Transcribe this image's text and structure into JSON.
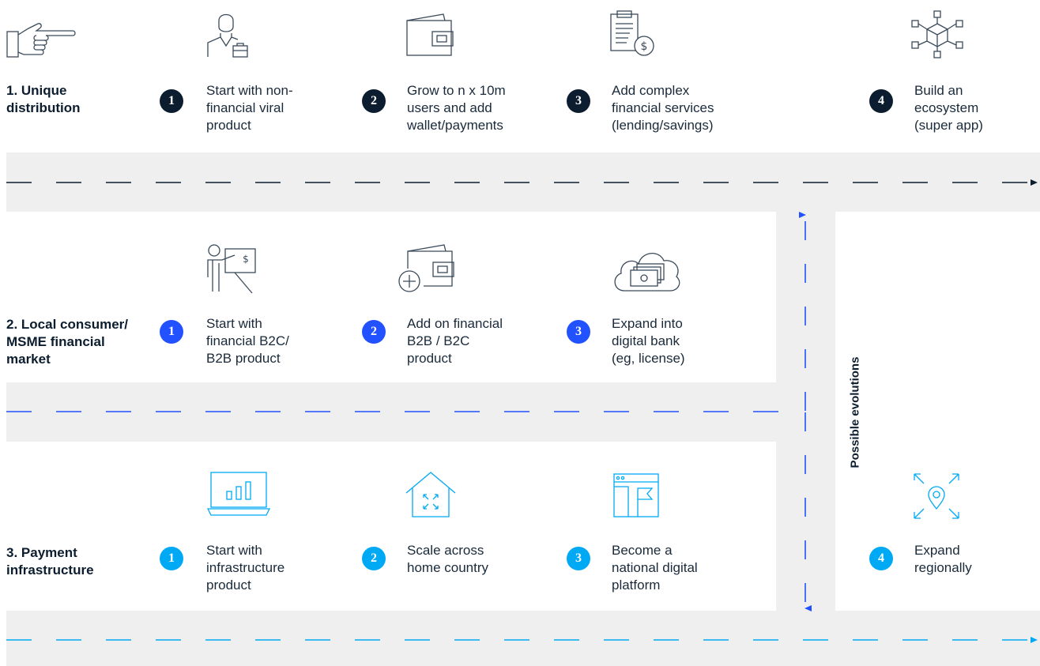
{
  "colors": {
    "navy": "#0b1d2e",
    "blue": "#2251ff",
    "cyan": "#00a9f4",
    "icon_gray": "#3b4a5a",
    "road": "#efefef"
  },
  "vertical_label": "Possible evolutions",
  "rows": [
    {
      "label": "1. Unique\ndistribution",
      "icon": "pointing-hand-icon",
      "steps": [
        {
          "num": "1",
          "text": "Start with non-\nfinancial viral\nproduct",
          "icon": "businessperson-briefcase-icon"
        },
        {
          "num": "2",
          "text": "Grow to n x 10m\nusers and add\nwallet/payments",
          "icon": "wallet-icon"
        },
        {
          "num": "3",
          "text": "Add complex\nfinancial services\n(lending/savings)",
          "icon": "clipboard-dollar-icon"
        },
        {
          "num": "4",
          "text": "Build an\necosystem\n(super app)",
          "icon": "network-cube-icon"
        }
      ]
    },
    {
      "label": "2. Local consumer/\nMSME financial\nmarket",
      "steps": [
        {
          "num": "1",
          "text": "Start with\nfinancial B2C/\nB2B product",
          "icon": "presenter-dollar-icon"
        },
        {
          "num": "2",
          "text": "Add on financial\nB2B / B2C\nproduct",
          "icon": "wallet-plus-icon"
        },
        {
          "num": "3",
          "text": "Expand into\ndigital bank\n(eg, license)",
          "icon": "cloud-money-icon"
        }
      ]
    },
    {
      "label": "3. Payment\ninfrastructure",
      "steps": [
        {
          "num": "1",
          "text": "Start with\ninfrastructure\nproduct",
          "icon": "laptop-chart-icon"
        },
        {
          "num": "2",
          "text": "Scale across\nhome country",
          "icon": "house-expand-icon"
        },
        {
          "num": "3",
          "text": "Become a\nnational digital\nplatform",
          "icon": "browser-flag-icon"
        },
        {
          "num": "4",
          "text": "Expand\nregionally",
          "icon": "location-expand-icon"
        }
      ]
    }
  ]
}
